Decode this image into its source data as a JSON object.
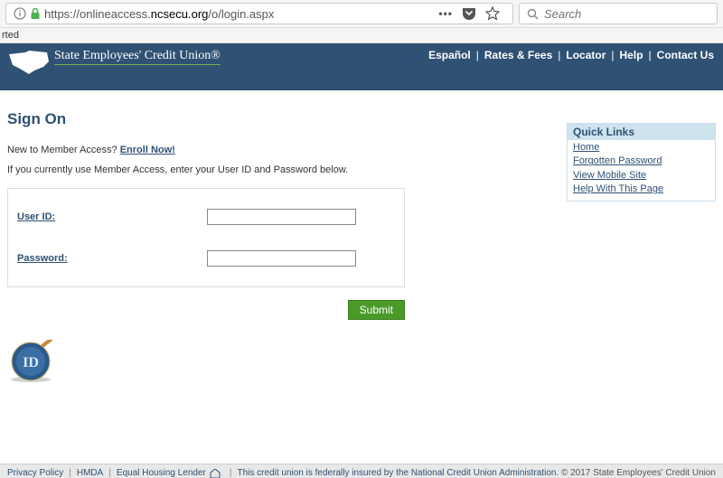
{
  "browser": {
    "url_prefix": "https://onlineaccess.",
    "url_domain": "ncsecu.org",
    "url_suffix": "/o/login.aspx",
    "search_placeholder": "Search",
    "bookmark_fragment": "rted"
  },
  "header": {
    "brand": "State Employees' Credit Union®",
    "nav": [
      "Español",
      "Rates & Fees",
      "Locator",
      "Help",
      "Contact Us"
    ]
  },
  "page": {
    "title": "Sign On",
    "new_prompt": "New to Member Access? ",
    "enroll_link": "Enroll Now!",
    "instructions": "If you currently use Member Access, enter your User ID and Password below.",
    "user_id_label": "User ID:",
    "password_label": "Password:",
    "submit_label": "Submit"
  },
  "quicklinks": {
    "title": "Quick Links",
    "items": [
      "Home",
      "Forgotten Password",
      "View Mobile Site",
      "Help With This Page"
    ]
  },
  "footer": {
    "links": [
      "Privacy Policy",
      "HMDA",
      "Equal Housing Lender"
    ],
    "disclosure": "This credit union is federally insured by the National Credit Union Administration.",
    "copyright": "© 2017 State Employees' Credit Union"
  }
}
